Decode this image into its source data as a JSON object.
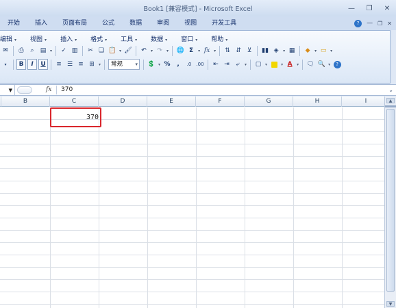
{
  "window": {
    "title": "Book1  [兼容模式] - Microsoft Excel"
  },
  "ribbon_tabs": [
    "开始",
    "插入",
    "页面布局",
    "公式",
    "数据",
    "审阅",
    "视图",
    "开发工具"
  ],
  "classic_menus": [
    "编辑",
    "视图",
    "插入",
    "格式",
    "工具",
    "数据",
    "窗口",
    "帮助"
  ],
  "toolbar": {
    "bold": "B",
    "italic": "I",
    "underline": "U",
    "number_format": "常规",
    "percent": "%",
    "comma": ",",
    "sum": "Σ",
    "fx": "fx",
    "font_color_glyph": "A",
    "icons": [
      "print-preview-icon",
      "print-icon",
      "spellcheck-icon",
      "cut-icon",
      "copy-icon",
      "paste-icon",
      "format-painter-icon",
      "undo-icon",
      "redo-icon",
      "hyperlink-icon",
      "sort-asc-icon",
      "sort-desc-icon",
      "chart-icon",
      "drawing-icon",
      "border-icon",
      "fill-color-icon",
      "font-color-icon"
    ]
  },
  "formula_bar": {
    "fx_label": "fx",
    "value": "370"
  },
  "columns": [
    "B",
    "C",
    "D",
    "E",
    "F",
    "G",
    "H",
    "I"
  ],
  "cells": {
    "C2": "370"
  },
  "colors": {
    "selection_border": "#d9262c",
    "ribbon_bg": "#dfe8f5",
    "tab_text": "#15306b"
  }
}
